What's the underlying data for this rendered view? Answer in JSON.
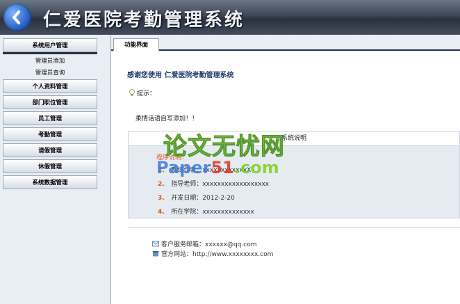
{
  "app": {
    "title": "仁爱医院考勤管理系统"
  },
  "sidebar": {
    "sections": [
      {
        "label": "系统用户管理",
        "items": [
          "管理员添加",
          "管理员查询"
        ]
      },
      {
        "label": "个人资料管理"
      },
      {
        "label": "部门职位管理"
      },
      {
        "label": "员工管理"
      },
      {
        "label": "考勤管理"
      },
      {
        "label": "请假管理"
      },
      {
        "label": "休假管理"
      },
      {
        "label": "系统数据管理"
      }
    ]
  },
  "tabs": [
    {
      "label": "功能界面"
    }
  ],
  "main": {
    "welcome": "感谢您使用 仁爱医院考勤管理系统",
    "tip_label": "提示：",
    "message": "柔情话语自写添加！！",
    "info": {
      "header": "系统说明",
      "title": "程序说明：",
      "rows": [
        {
          "num": "1、",
          "text": "系统作者：xxxxxxxxxxxxX"
        },
        {
          "num": "2、",
          "text": "指导老师：xxxxxxxxxxxxxxxxxx"
        },
        {
          "num": "3、",
          "text": "开发日期：2012-2-20"
        },
        {
          "num": "4、",
          "text": "所在学院：xxxxxxxxxxxxxx"
        }
      ]
    },
    "contact": {
      "email": "客户服务邮箱：xxxxxx@qq.com",
      "website": "官方网站：http://www.xxxxxxxx.com"
    }
  },
  "watermark": {
    "line1": "论文无忧网",
    "line2a": "Paper",
    "line2b": "51",
    "line2c": ".com"
  },
  "colors": {
    "header_dark": "#2a3240",
    "sidebar_bg": "#e9eef5",
    "accent_orange": "#e2541c",
    "title_blue": "#223c6c"
  }
}
